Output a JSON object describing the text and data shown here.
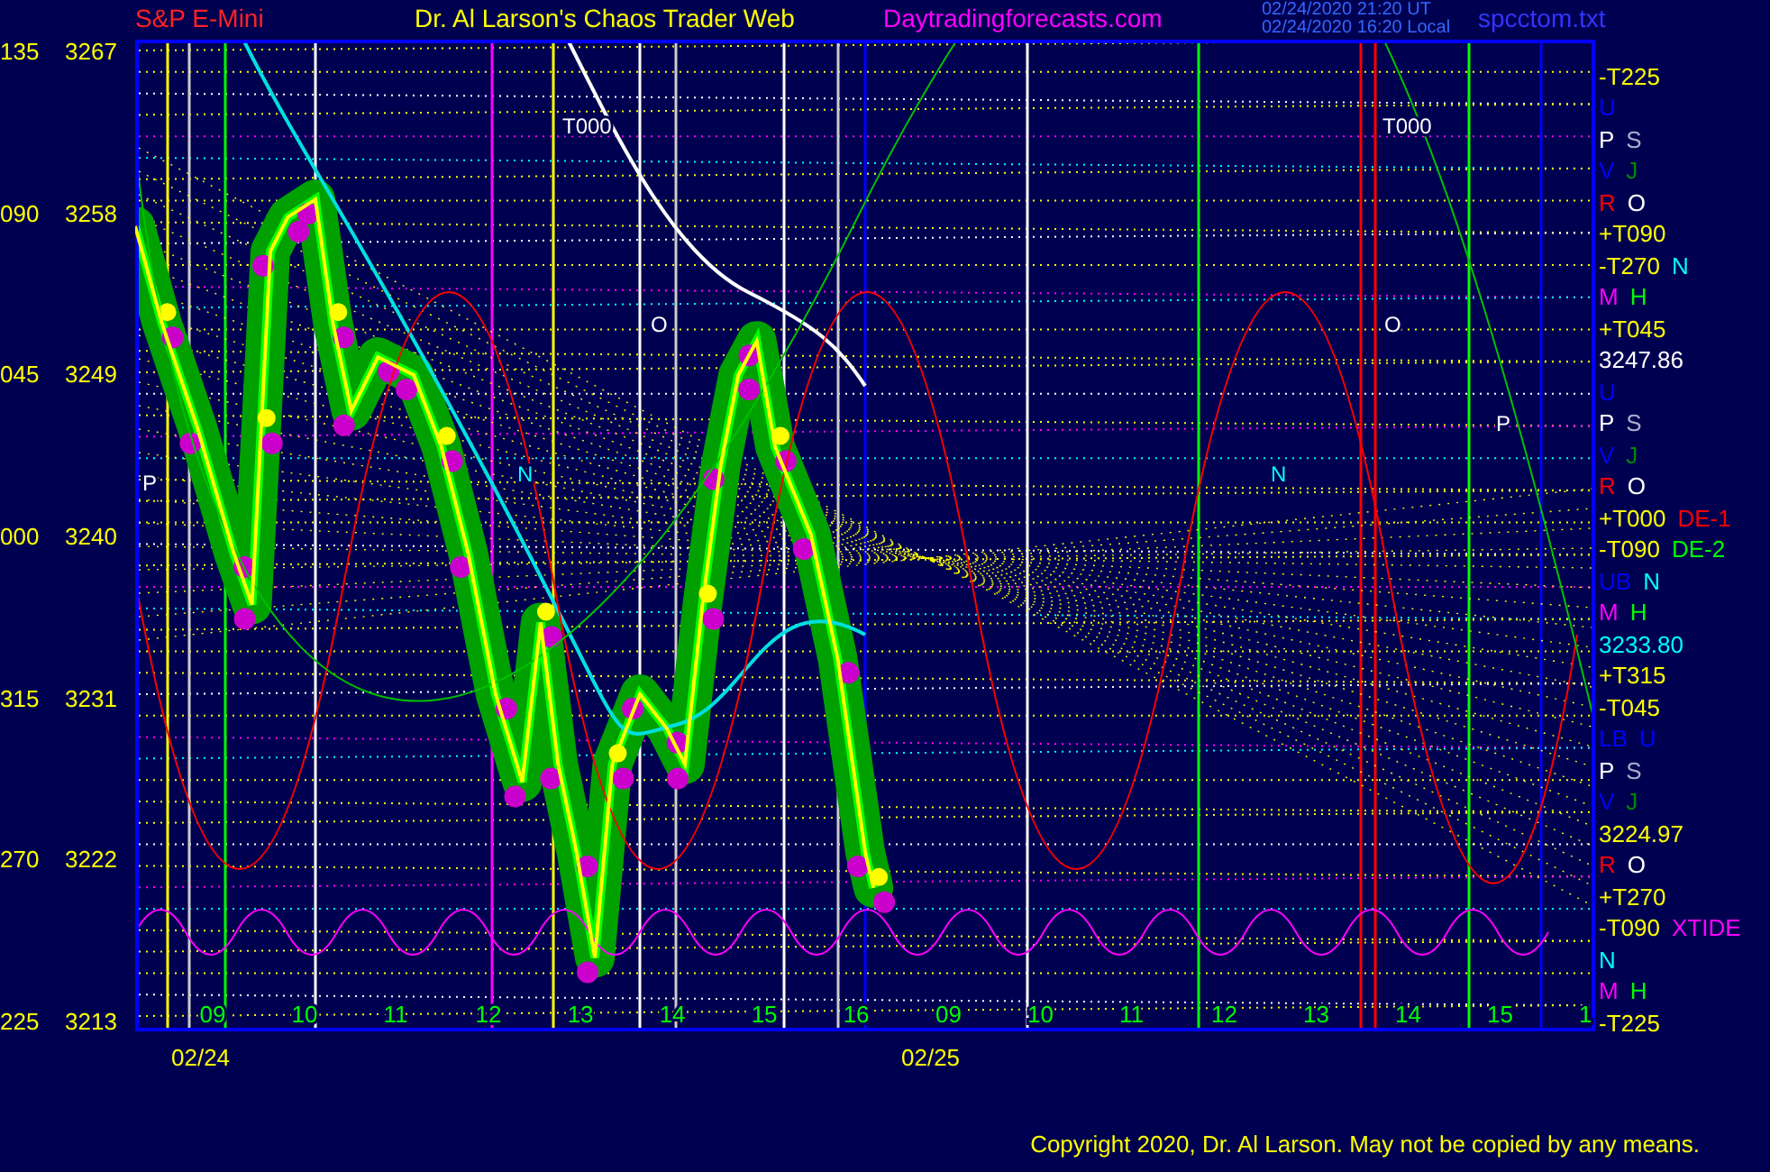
{
  "header": {
    "title": "Dr. Al Larson's Chaos Trader Web",
    "site": "Daytradingforecasts.com",
    "timestamp_utc": "02/24/2020 21:20 UT",
    "timestamp_local": "02/24/2020 16:20 Local",
    "file": "spcctom.txt"
  },
  "y_angles": [
    "135",
    "090",
    "045",
    "000",
    "315",
    "270",
    "225"
  ],
  "chart_data": {
    "type": "line",
    "xlim": [
      8.22,
      24.1
    ],
    "ylim": [
      3212.5,
      3267.6
    ],
    "yticks": [
      3267,
      3258,
      3249,
      3240,
      3231,
      3222,
      3213
    ],
    "xticks": [
      {
        "value": 9,
        "label": "09"
      },
      10,
      11,
      12,
      13,
      14,
      15,
      16
    ],
    "series": [
      {
        "name": "S&P E-Mini",
        "color": "#ffff00",
        "values": [
          3257.3,
          3251.9,
          3246.0,
          3239.1,
          3236.2,
          3246.0,
          3255.9,
          3257.8,
          3258.8,
          3251.9,
          3247.0,
          3250.0,
          3249.0,
          3245.0,
          3239.1,
          3231.2,
          3226.3,
          3235.2,
          3227.3,
          3222.4,
          3216.5,
          3227.3,
          3231.2,
          3229.3,
          3227.3,
          3236.2,
          3244.0,
          3249.0,
          3250.9,
          3245.0,
          3240.1,
          3233.2,
          3222.4,
          3220.4
        ]
      }
    ],
    "x": [
      8.22,
      8.51,
      8.9,
      9.29,
      9.49,
      9.59,
      9.69,
      9.88,
      10.18,
      10.37,
      10.57,
      10.86,
      11.25,
      11.55,
      11.84,
      12.14,
      12.43,
      12.63,
      12.82,
      13.02,
      13.22,
      13.41,
      13.71,
      14.0,
      14.2,
      14.39,
      14.59,
      14.78,
      14.98,
      15.18,
      15.57,
      15.86,
      16.16,
      16.25
    ]
  },
  "next_day_hours": [
    "09",
    "10",
    "11",
    "12",
    "13",
    "14",
    "15",
    "1"
  ],
  "chart_labels": [
    {
      "text": "T000",
      "color": "#ffffff"
    },
    {
      "text": "T000",
      "color": "#ffffff"
    },
    {
      "text": "N",
      "color": "#00ffff"
    },
    {
      "text": "N",
      "color": "#00ffff"
    },
    {
      "text": "P",
      "color": "#ffffff"
    },
    {
      "text": "P",
      "color": "#ffffff"
    },
    {
      "text": "O",
      "color": "#ffffff"
    },
    {
      "text": "O",
      "color": "#ffffff"
    }
  ],
  "dates": [
    "02/24",
    "02/25"
  ],
  "right_rows": [
    {
      "items": [
        {
          "text": "-T225",
          "color": "#ffff00"
        }
      ]
    },
    {
      "items": [
        {
          "text": "U",
          "color": "#0000ff"
        }
      ]
    },
    {
      "items": [
        {
          "text": "P",
          "color": "#ffffff"
        },
        {
          "text": "S",
          "color": "#aaaacc"
        }
      ]
    },
    {
      "items": [
        {
          "text": "V",
          "color": "#0000ff"
        },
        {
          "text": "J",
          "color": "#008800"
        }
      ]
    },
    {
      "items": [
        {
          "text": "R",
          "color": "#ff0000"
        },
        {
          "text": "O",
          "color": "#ffffff"
        }
      ]
    },
    {
      "items": [
        {
          "text": "+T090",
          "color": "#ffff00"
        }
      ]
    },
    {
      "items": [
        {
          "text": "-T270",
          "color": "#ffff00"
        },
        {
          "text": "N",
          "color": "#00ffff"
        }
      ]
    },
    {
      "items": [
        {
          "text": "M",
          "color": "#ff00ff"
        },
        {
          "text": "H",
          "color": "#00ff00"
        }
      ]
    },
    {
      "items": [
        {
          "text": "+T045",
          "color": "#ffff00"
        }
      ]
    },
    {
      "items": [
        {
          "text": "3247.86",
          "color": "#ffffff"
        }
      ]
    },
    {
      "items": [
        {
          "text": "U",
          "color": "#0000ff"
        }
      ]
    },
    {
      "items": [
        {
          "text": "P",
          "color": "#ffffff"
        },
        {
          "text": "S",
          "color": "#aaaacc"
        }
      ]
    },
    {
      "items": [
        {
          "text": "V",
          "color": "#0000ff"
        },
        {
          "text": "J",
          "color": "#008800"
        }
      ]
    },
    {
      "items": [
        {
          "text": "R",
          "color": "#ff0000"
        },
        {
          "text": "O",
          "color": "#ffffff"
        }
      ]
    },
    {
      "items": [
        {
          "text": "+T000",
          "color": "#ffff00"
        },
        {
          "text": "DE-1",
          "color": "#ff0000"
        }
      ]
    },
    {
      "items": [
        {
          "text": "-T090",
          "color": "#ffff00"
        },
        {
          "text": "DE-2",
          "color": "#00ff00"
        }
      ]
    },
    {
      "items": [
        {
          "text": "UB",
          "color": "#0000ff"
        },
        {
          "text": "N",
          "color": "#00ffff"
        }
      ]
    },
    {
      "items": [
        {
          "text": "M",
          "color": "#ff00ff"
        },
        {
          "text": "H",
          "color": "#00ff00"
        }
      ]
    },
    {
      "items": [
        {
          "text": "3233.80",
          "color": "#00ffff"
        }
      ]
    },
    {
      "items": [
        {
          "text": "+T315",
          "color": "#ffff00"
        }
      ]
    },
    {
      "items": [
        {
          "text": "-T045",
          "color": "#ffff00"
        }
      ]
    },
    {
      "items": [
        {
          "text": "LB",
          "color": "#0000ff"
        },
        {
          "text": "U",
          "color": "#0000ff"
        }
      ]
    },
    {
      "items": [
        {
          "text": "P",
          "color": "#ffffff"
        },
        {
          "text": "S",
          "color": "#aaaacc"
        }
      ]
    },
    {
      "items": [
        {
          "text": "V",
          "color": "#0000ff"
        },
        {
          "text": "J",
          "color": "#008800"
        }
      ]
    },
    {
      "items": [
        {
          "text": "3224.97",
          "color": "#ffff00"
        }
      ]
    },
    {
      "items": [
        {
          "text": "R",
          "color": "#ff0000"
        },
        {
          "text": "O",
          "color": "#ffffff"
        }
      ]
    },
    {
      "items": [
        {
          "text": "+T270",
          "color": "#ffff00"
        }
      ]
    },
    {
      "items": [
        {
          "text": "-T090",
          "color": "#ffff00"
        },
        {
          "text": "XTIDE",
          "color": "#ff00ff"
        }
      ]
    },
    {
      "items": [
        {
          "text": "N",
          "color": "#00ffff"
        }
      ]
    },
    {
      "items": [
        {
          "text": "M",
          "color": "#ff00ff"
        },
        {
          "text": "H",
          "color": "#00ff00"
        }
      ]
    },
    {
      "items": [
        {
          "text": "-T225",
          "color": "#ffff00"
        }
      ]
    }
  ],
  "copyright": "Copyright 2020, Dr. Al Larson. May not be copied by any means."
}
